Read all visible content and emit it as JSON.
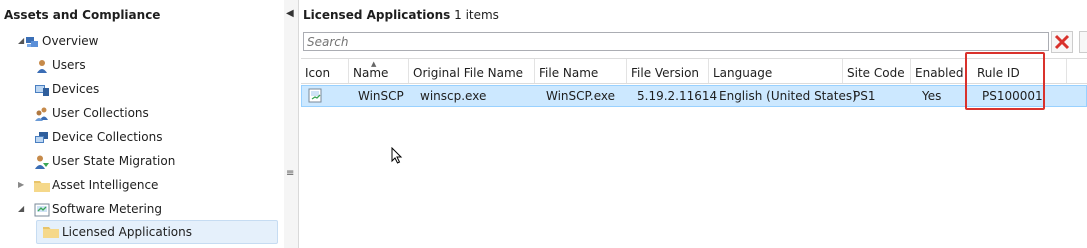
{
  "nav": {
    "title": "Assets and Compliance",
    "items": [
      {
        "label": "Overview",
        "icon": "overview-icon",
        "expander": "◢"
      },
      {
        "label": "Users",
        "icon": "user-icon"
      },
      {
        "label": "Devices",
        "icon": "devices-icon"
      },
      {
        "label": "User Collections",
        "icon": "user-collections-icon"
      },
      {
        "label": "Device Collections",
        "icon": "device-collections-icon"
      },
      {
        "label": "User State Migration",
        "icon": "user-state-migration-icon"
      },
      {
        "label": "Asset Intelligence",
        "icon": "folder-icon",
        "expander": "▶"
      },
      {
        "label": "Software Metering",
        "icon": "software-metering-icon",
        "expander": "◢"
      },
      {
        "label": "Licensed Applications",
        "icon": "folder-icon",
        "selected": true
      }
    ]
  },
  "content": {
    "title": "Licensed Applications",
    "count_text": "1 items",
    "search_placeholder": "Search",
    "columns": [
      "Icon",
      "Name",
      "Original File Name",
      "File Name",
      "File Version",
      "Language",
      "Site Code",
      "Enabled",
      "Rule ID"
    ],
    "rows": [
      {
        "name": "WinSCP",
        "original_file_name": "winscp.exe",
        "file_name": "WinSCP.exe",
        "file_version": "5.19.2.11614",
        "language": "English (United States)",
        "site_code": "PS1",
        "enabled": "Yes",
        "rule_id": "PS100001"
      }
    ]
  },
  "colors": {
    "highlight": "#d9322c",
    "selection": "#cce8ff",
    "clear_x": "#d9322c"
  }
}
